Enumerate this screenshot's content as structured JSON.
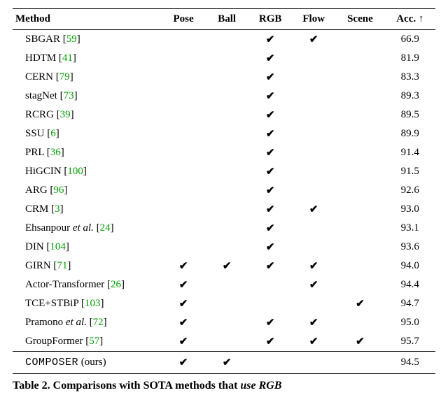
{
  "header": {
    "method": "Method",
    "pose": "Pose",
    "ball": "Ball",
    "rgb": "RGB",
    "flow": "Flow",
    "scene": "Scene",
    "acc": "Acc. ↑"
  },
  "checkmark": "✔",
  "rows": [
    {
      "name": "SBGAR",
      "cite": "59",
      "etal": false,
      "pose": false,
      "ball": false,
      "rgb": true,
      "flow": true,
      "scene": false,
      "acc": "66.9"
    },
    {
      "name": "HDTM",
      "cite": "41",
      "etal": false,
      "pose": false,
      "ball": false,
      "rgb": true,
      "flow": false,
      "scene": false,
      "acc": "81.9"
    },
    {
      "name": "CERN",
      "cite": "79",
      "etal": false,
      "pose": false,
      "ball": false,
      "rgb": true,
      "flow": false,
      "scene": false,
      "acc": "83.3"
    },
    {
      "name": "stagNet",
      "cite": "73",
      "etal": false,
      "pose": false,
      "ball": false,
      "rgb": true,
      "flow": false,
      "scene": false,
      "acc": "89.3"
    },
    {
      "name": "RCRG",
      "cite": "39",
      "etal": false,
      "pose": false,
      "ball": false,
      "rgb": true,
      "flow": false,
      "scene": false,
      "acc": "89.5"
    },
    {
      "name": "SSU",
      "cite": "6",
      "etal": false,
      "pose": false,
      "ball": false,
      "rgb": true,
      "flow": false,
      "scene": false,
      "acc": "89.9"
    },
    {
      "name": "PRL",
      "cite": "36",
      "etal": false,
      "pose": false,
      "ball": false,
      "rgb": true,
      "flow": false,
      "scene": false,
      "acc": "91.4"
    },
    {
      "name": "HiGCIN",
      "cite": "100",
      "etal": false,
      "pose": false,
      "ball": false,
      "rgb": true,
      "flow": false,
      "scene": false,
      "acc": "91.5"
    },
    {
      "name": "ARG",
      "cite": "96",
      "etal": false,
      "pose": false,
      "ball": false,
      "rgb": true,
      "flow": false,
      "scene": false,
      "acc": "92.6"
    },
    {
      "name": "CRM",
      "cite": "3",
      "etal": false,
      "pose": false,
      "ball": false,
      "rgb": true,
      "flow": true,
      "scene": false,
      "acc": "93.0"
    },
    {
      "name": "Ehsanpour",
      "cite": "24",
      "etal": true,
      "pose": false,
      "ball": false,
      "rgb": true,
      "flow": false,
      "scene": false,
      "acc": "93.1"
    },
    {
      "name": "DIN",
      "cite": "104",
      "etal": false,
      "pose": false,
      "ball": false,
      "rgb": true,
      "flow": false,
      "scene": false,
      "acc": "93.6"
    },
    {
      "name": "GIRN",
      "cite": "71",
      "etal": false,
      "pose": true,
      "ball": true,
      "rgb": true,
      "flow": true,
      "scene": false,
      "acc": "94.0"
    },
    {
      "name": "Actor-Transformer",
      "cite": "26",
      "etal": false,
      "pose": true,
      "ball": false,
      "rgb": false,
      "flow": true,
      "scene": false,
      "acc": "94.4"
    },
    {
      "name": "TCE+STBiP",
      "cite": "103",
      "etal": false,
      "pose": true,
      "ball": false,
      "rgb": false,
      "flow": false,
      "scene": true,
      "acc": "94.7"
    },
    {
      "name": "Pramono",
      "cite": "72",
      "etal": true,
      "pose": true,
      "ball": false,
      "rgb": true,
      "flow": true,
      "scene": false,
      "acc": "95.0"
    },
    {
      "name": "GroupFormer",
      "cite": "57",
      "etal": false,
      "pose": true,
      "ball": false,
      "rgb": true,
      "flow": true,
      "scene": true,
      "acc": "95.7"
    }
  ],
  "ours": {
    "name": "COMPOSER",
    "suffix": " (ours)",
    "pose": true,
    "ball": true,
    "rgb": false,
    "flow": false,
    "scene": false,
    "acc": "94.5"
  },
  "caption": {
    "label": "Table 2.",
    "text_bold": "  Comparisons with SOTA methods that ",
    "text_ital": "use RGB"
  }
}
